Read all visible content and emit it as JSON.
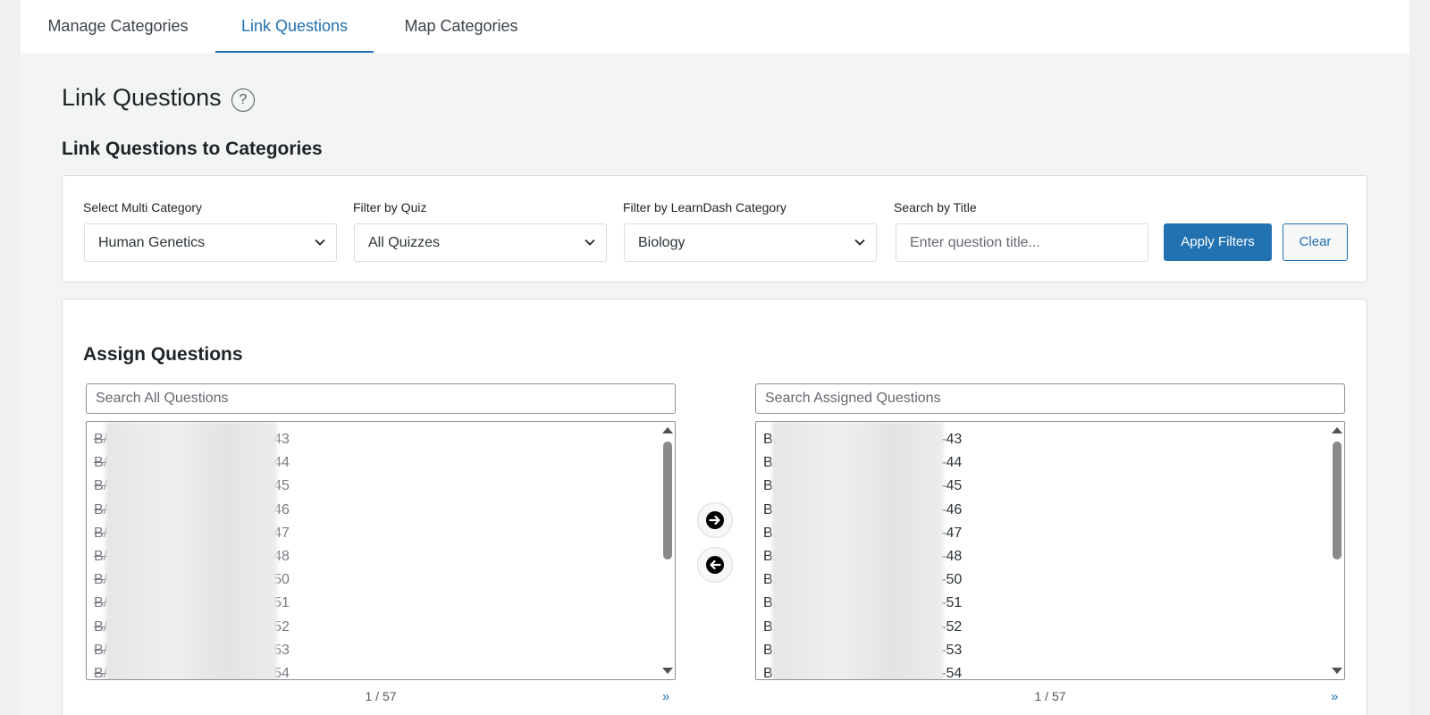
{
  "tabs": [
    {
      "label": "Manage Categories"
    },
    {
      "label": "Link Questions"
    },
    {
      "label": "Map Categories"
    }
  ],
  "page_title": "Link Questions",
  "help_symbol": "?",
  "section_title": "Link Questions to Categories",
  "filters": {
    "multi_category": {
      "label": "Select Multi Category",
      "value": "Human Genetics"
    },
    "quiz": {
      "label": "Filter by Quiz",
      "value": "All Quizzes"
    },
    "ld_category": {
      "label": "Filter by LearnDash Category",
      "value": "Biology"
    },
    "search": {
      "label": "Search by Title",
      "placeholder": "Enter question title..."
    },
    "apply_label": "Apply Filters",
    "clear_label": "Clear"
  },
  "assign": {
    "title": "Assign Questions",
    "all": {
      "search_placeholder": "Search All Questions",
      "items": [
        {
          "prefix": "B/",
          "suffix": "43"
        },
        {
          "prefix": "B/",
          "suffix": "44"
        },
        {
          "prefix": "B/",
          "suffix": "45"
        },
        {
          "prefix": "B/",
          "suffix": "46"
        },
        {
          "prefix": "B/",
          "suffix": "47"
        },
        {
          "prefix": "B/",
          "suffix": "48"
        },
        {
          "prefix": "B/",
          "suffix": "50"
        },
        {
          "prefix": "B/",
          "suffix": "51"
        },
        {
          "prefix": "B/",
          "suffix": "52"
        },
        {
          "prefix": "B/",
          "suffix": "53"
        },
        {
          "prefix": "B/",
          "suffix": "54"
        }
      ],
      "pager": "1 / 57",
      "next": "»"
    },
    "assigned": {
      "search_placeholder": "Search Assigned Questions",
      "items": [
        {
          "prefix": "B.",
          "suffix": "-43"
        },
        {
          "prefix": "B.",
          "suffix": "-44"
        },
        {
          "prefix": "B.",
          "suffix": "-45"
        },
        {
          "prefix": "B.",
          "suffix": "-46"
        },
        {
          "prefix": "B.",
          "suffix": "-47"
        },
        {
          "prefix": "B.",
          "suffix": "-48"
        },
        {
          "prefix": "B.",
          "suffix": "-50"
        },
        {
          "prefix": "B.",
          "suffix": "-51"
        },
        {
          "prefix": "B.",
          "suffix": "-52"
        },
        {
          "prefix": "B.",
          "suffix": "-53"
        },
        {
          "prefix": "B.",
          "suffix": "-54"
        }
      ],
      "pager": "1 / 57",
      "next": "»"
    },
    "move_right_icon": "arrow-right-circle-icon",
    "move_left_icon": "arrow-left-circle-icon"
  },
  "colors": {
    "accent": "#2271b1",
    "panel_bg": "#f3f5f4",
    "border": "#dcdcde"
  }
}
